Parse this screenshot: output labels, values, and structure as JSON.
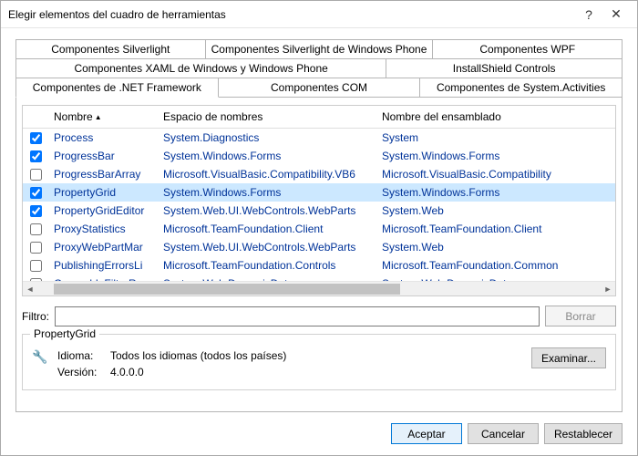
{
  "window": {
    "title": "Elegir elementos del cuadro de herramientas"
  },
  "tabs": {
    "row1": [
      "Componentes Silverlight",
      "Componentes Silverlight de Windows Phone",
      "Componentes WPF"
    ],
    "row2": [
      "Componentes XAML de Windows y Windows Phone",
      "InstallShield Controls"
    ],
    "row3": [
      "Componentes de .NET Framework",
      "Componentes COM",
      "Componentes de System.Activities"
    ],
    "activeRow3Index": 0
  },
  "grid": {
    "headers": {
      "name": "Nombre",
      "ns": "Espacio de nombres",
      "asm": "Nombre del ensamblado"
    },
    "rows": [
      {
        "checked": true,
        "name": "Process",
        "ns": "System.Diagnostics",
        "asm": "System"
      },
      {
        "checked": true,
        "name": "ProgressBar",
        "ns": "System.Windows.Forms",
        "asm": "System.Windows.Forms"
      },
      {
        "checked": false,
        "name": "ProgressBarArray",
        "ns": "Microsoft.VisualBasic.Compatibility.VB6",
        "asm": "Microsoft.VisualBasic.Compatibility"
      },
      {
        "checked": true,
        "name": "PropertyGrid",
        "ns": "System.Windows.Forms",
        "asm": "System.Windows.Forms",
        "selected": true
      },
      {
        "checked": true,
        "name": "PropertyGridEditor",
        "ns": "System.Web.UI.WebControls.WebParts",
        "asm": "System.Web"
      },
      {
        "checked": false,
        "name": "ProxyStatistics",
        "ns": "Microsoft.TeamFoundation.Client",
        "asm": "Microsoft.TeamFoundation.Client"
      },
      {
        "checked": false,
        "name": "ProxyWebPartMar",
        "ns": "System.Web.UI.WebControls.WebParts",
        "asm": "System.Web"
      },
      {
        "checked": false,
        "name": "PublishingErrorsLi",
        "ns": "Microsoft.TeamFoundation.Controls",
        "asm": "Microsoft.TeamFoundation.Common"
      },
      {
        "checked": false,
        "name": "QueryableFilterRep",
        "ns": "System.Web.DynamicData",
        "asm": "System.Web.DynamicData"
      }
    ]
  },
  "filter": {
    "label": "Filtro:",
    "value": "",
    "clear": "Borrar"
  },
  "details": {
    "legend": "PropertyGrid",
    "lang_label": "Idioma:",
    "lang_value": "Todos los idiomas (todos los países)",
    "ver_label": "Versión:",
    "ver_value": "4.0.0.0",
    "browse": "Examinar..."
  },
  "footer": {
    "ok": "Aceptar",
    "cancel": "Cancelar",
    "reset": "Restablecer"
  }
}
